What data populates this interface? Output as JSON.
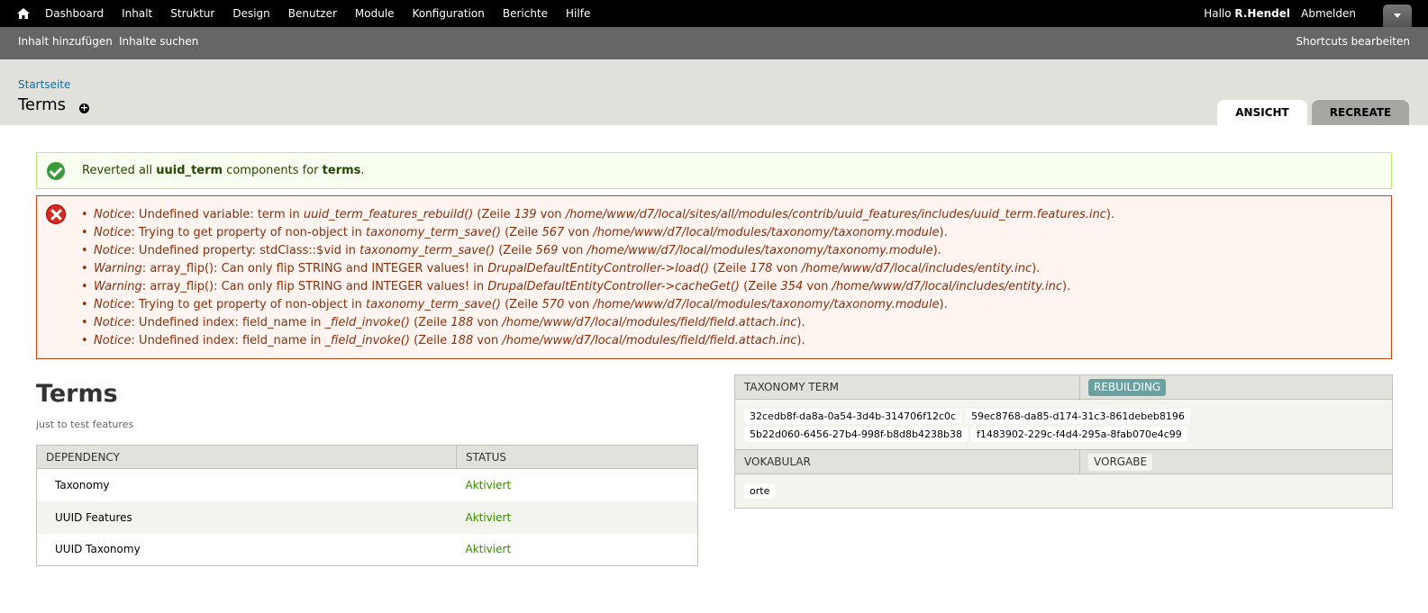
{
  "toolbar": {
    "home_icon": "home-icon",
    "menu": [
      "Dashboard",
      "Inhalt",
      "Struktur",
      "Design",
      "Benutzer",
      "Module",
      "Konfiguration",
      "Berichte",
      "Hilfe"
    ],
    "greeting": "Hallo",
    "username": "R.Hendel",
    "logout": "Abmelden"
  },
  "shortcuts": {
    "add_content": "Inhalt hinzufügen",
    "find_content": "Inhalte suchen",
    "edit_shortcuts": "Shortcuts bearbeiten"
  },
  "header": {
    "breadcrumb": "Startseite",
    "title": "Terms",
    "tabs": [
      {
        "label": "ANSICHT",
        "active": true
      },
      {
        "label": "RECREATE",
        "active": false
      }
    ]
  },
  "status_message": {
    "prefix": "Reverted all",
    "component": "uuid_term",
    "middle": "components for",
    "feature": "terms",
    "suffix": "."
  },
  "error_messages": [
    {
      "type": "Notice",
      "text": ": Undefined variable: term in ",
      "func": "uuid_term_features_rebuild()",
      "mid": " (Zeile ",
      "line": "139",
      "von": " von ",
      "file": "/home/www/d7/local/sites/all/modules/contrib/uuid_features/includes/uuid_term.features.inc",
      "end": ")."
    },
    {
      "type": "Notice",
      "text": ": Trying to get property of non-object in ",
      "func": "taxonomy_term_save()",
      "mid": " (Zeile ",
      "line": "567",
      "von": " von ",
      "file": "/home/www/d7/local/modules/taxonomy/taxonomy.module",
      "end": ")."
    },
    {
      "type": "Notice",
      "text": ": Undefined property: stdClass::$vid in ",
      "func": "taxonomy_term_save()",
      "mid": " (Zeile ",
      "line": "569",
      "von": " von ",
      "file": "/home/www/d7/local/modules/taxonomy/taxonomy.module",
      "end": ")."
    },
    {
      "type": "Warning",
      "text": ": array_flip(): Can only flip STRING and INTEGER values! in ",
      "func": "DrupalDefaultEntityController->load()",
      "mid": " (Zeile ",
      "line": "178",
      "von": " von ",
      "file": "/home/www/d7/local/includes/entity.inc",
      "end": ")."
    },
    {
      "type": "Warning",
      "text": ": array_flip(): Can only flip STRING and INTEGER values! in ",
      "func": "DrupalDefaultEntityController->cacheGet()",
      "mid": " (Zeile ",
      "line": "354",
      "von": " von ",
      "file": "/home/www/d7/local/includes/entity.inc",
      "end": ")."
    },
    {
      "type": "Notice",
      "text": ": Trying to get property of non-object in ",
      "func": "taxonomy_term_save()",
      "mid": " (Zeile ",
      "line": "570",
      "von": " von ",
      "file": "/home/www/d7/local/modules/taxonomy/taxonomy.module",
      "end": ")."
    },
    {
      "type": "Notice",
      "text": ": Undefined index: field_name in ",
      "func": "_field_invoke()",
      "mid": " (Zeile ",
      "line": "188",
      "von": " von ",
      "file": "/home/www/d7/local/modules/field/field.attach.inc",
      "end": ")."
    },
    {
      "type": "Notice",
      "text": ": Undefined index: field_name in ",
      "func": "_field_invoke()",
      "mid": " (Zeile ",
      "line": "188",
      "von": " von ",
      "file": "/home/www/d7/local/modules/field/field.attach.inc",
      "end": ")."
    }
  ],
  "feature": {
    "title": "Terms",
    "description": "just to test features",
    "table": {
      "headers": [
        "DEPENDENCY",
        "STATUS"
      ],
      "rows": [
        {
          "name": "Taxonomy",
          "status": "Aktiviert"
        },
        {
          "name": "UUID Features",
          "status": "Aktiviert"
        },
        {
          "name": "UUID Taxonomy",
          "status": "Aktiviert"
        }
      ]
    }
  },
  "components": {
    "taxonomy": {
      "label": "TAXONOMY TERM",
      "state": "REBUILDING",
      "items": [
        "32cedb8f-da8a-0a54-3d4b-314706f12c0c",
        "59ec8768-da85-d174-31c3-861debeb8196",
        "5b22d060-6456-27b4-998f-b8d8b4238b38",
        "f1483902-229c-f4d4-295a-8fab070e4c99"
      ]
    },
    "vocabulary": {
      "label": "VOKABULAR",
      "state": "VORGABE",
      "items": [
        "orte"
      ]
    }
  },
  "colors": {
    "status_ok": "#398a00",
    "rebuilding_badge": "#6aa0a0",
    "error_text": "#8c2e0b",
    "link": "#0074bd"
  }
}
